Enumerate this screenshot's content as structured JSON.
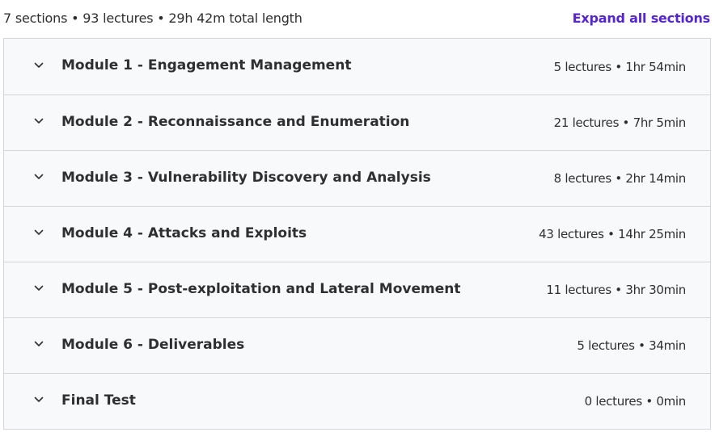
{
  "summary": {
    "text": "7 sections • 93 lectures • 29h 42m total length",
    "expand_label": "Expand all sections"
  },
  "sections": [
    {
      "title": "Module 1 - Engagement Management",
      "meta": "5 lectures • 1hr 54min"
    },
    {
      "title": "Module 2 - Reconnaissance and Enumeration",
      "meta": "21 lectures • 7hr 5min"
    },
    {
      "title": "Module 3 - Vulnerability Discovery and Analysis",
      "meta": "8 lectures • 2hr 14min"
    },
    {
      "title": "Module 4 - Attacks and Exploits",
      "meta": "43 lectures • 14hr 25min"
    },
    {
      "title": "Module 5 - Post-exploitation and Lateral Movement",
      "meta": "11 lectures • 3hr 30min"
    },
    {
      "title": "Module 6 - Deliverables",
      "meta": "5 lectures • 34min"
    },
    {
      "title": "Final Test",
      "meta": "0 lectures • 0min"
    }
  ],
  "icons": {
    "section_toggle": "chevron-down-icon"
  },
  "colors": {
    "accent": "#5624d0",
    "row_background": "#f7f9fa",
    "border": "#d1d7dc",
    "text": "#2d2f31"
  }
}
